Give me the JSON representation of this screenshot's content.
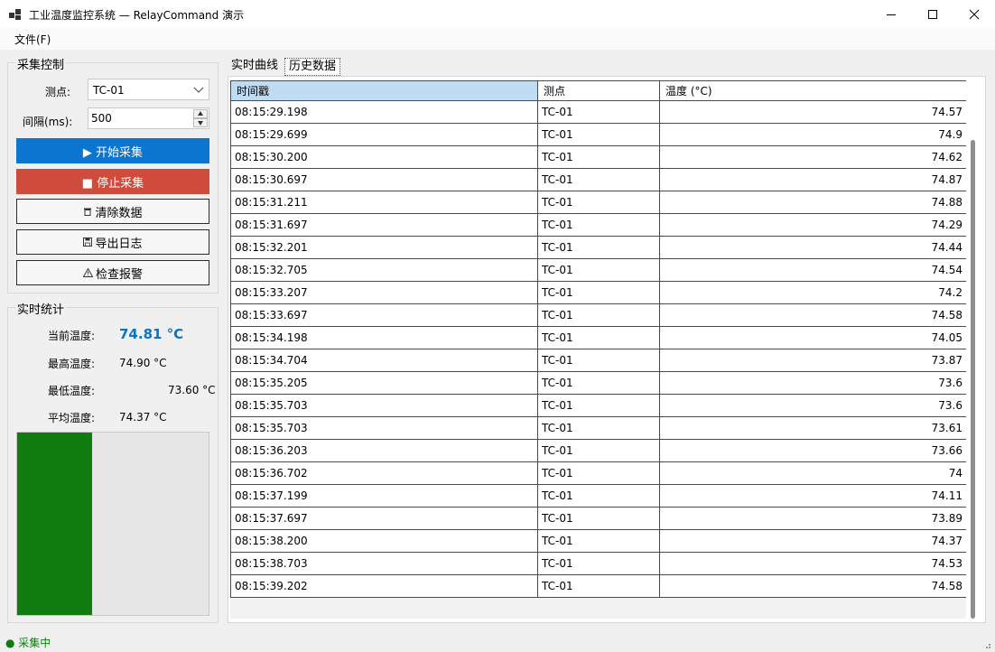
{
  "window": {
    "title": "工业温度监控系统 — RelayCommand 演示"
  },
  "menu": {
    "file": "文件(F)"
  },
  "control_group": {
    "title": "采集控制",
    "point_label": "测点:",
    "point_value": "TC-01",
    "interval_label": "间隔(ms):",
    "interval_value": "500",
    "start_button": "▶ 开始采集",
    "stop_button": "■ 停止采集",
    "clear_button": "清除数据",
    "export_button": "导出日志",
    "alarm_button": "检查报警"
  },
  "stats_group": {
    "title": "实时统计",
    "current_label": "当前温度:",
    "current_value": "74.81 °C",
    "max_label": "最高温度:",
    "max_value": "74.90 °C",
    "min_label": "最低温度:",
    "min_value": "73.60 °C",
    "avg_label": "平均温度:",
    "avg_value": "74.37 °C",
    "level_fraction": 0.39
  },
  "tabs": [
    {
      "label": "实时曲线",
      "selected": false
    },
    {
      "label": "历史数据",
      "selected": true
    }
  ],
  "grid": {
    "columns": [
      "时间戳",
      "测点",
      "温度 (°C)"
    ],
    "rows": [
      [
        "08:15:29.198",
        "TC-01",
        "74.57"
      ],
      [
        "08:15:29.699",
        "TC-01",
        "74.9"
      ],
      [
        "08:15:30.200",
        "TC-01",
        "74.62"
      ],
      [
        "08:15:30.697",
        "TC-01",
        "74.87"
      ],
      [
        "08:15:31.211",
        "TC-01",
        "74.88"
      ],
      [
        "08:15:31.697",
        "TC-01",
        "74.29"
      ],
      [
        "08:15:32.201",
        "TC-01",
        "74.44"
      ],
      [
        "08:15:32.705",
        "TC-01",
        "74.54"
      ],
      [
        "08:15:33.207",
        "TC-01",
        "74.2"
      ],
      [
        "08:15:33.697",
        "TC-01",
        "74.58"
      ],
      [
        "08:15:34.198",
        "TC-01",
        "74.05"
      ],
      [
        "08:15:34.704",
        "TC-01",
        "73.87"
      ],
      [
        "08:15:35.205",
        "TC-01",
        "73.6"
      ],
      [
        "08:15:35.703",
        "TC-01",
        "73.6"
      ],
      [
        "08:15:35.703",
        "TC-01",
        "73.61"
      ],
      [
        "08:15:36.203",
        "TC-01",
        "73.66"
      ],
      [
        "08:15:36.702",
        "TC-01",
        "74"
      ],
      [
        "08:15:37.199",
        "TC-01",
        "74.11"
      ],
      [
        "08:15:37.697",
        "TC-01",
        "73.89"
      ],
      [
        "08:15:38.200",
        "TC-01",
        "74.37"
      ],
      [
        "08:15:38.703",
        "TC-01",
        "74.53"
      ],
      [
        "08:15:39.202",
        "TC-01",
        "74.58"
      ]
    ]
  },
  "status": {
    "text": "● 采集中"
  },
  "colors": {
    "start_button": "#0b75d0",
    "stop_button": "#cf4c3c",
    "level_bar": "#107c10",
    "current_temp": "#0b72c8",
    "status_text": "#107c10"
  }
}
